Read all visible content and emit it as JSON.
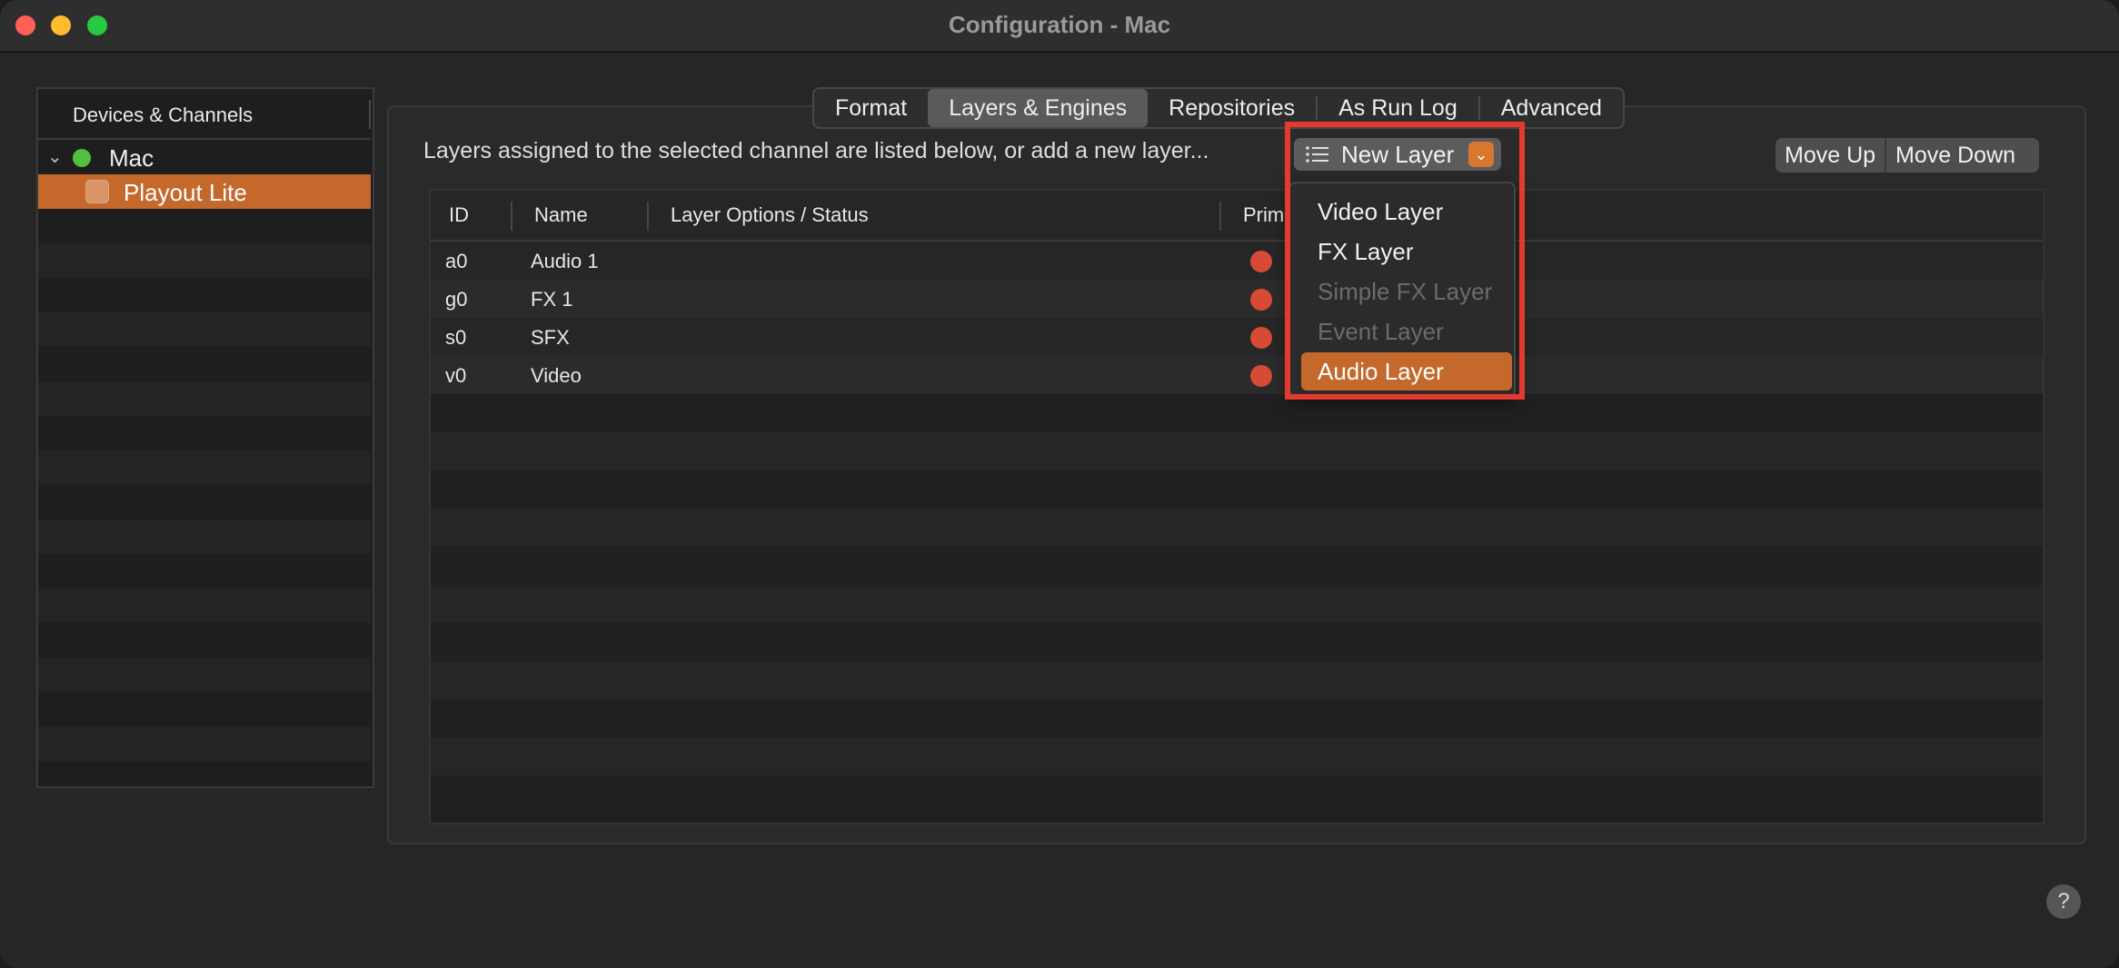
{
  "window": {
    "title": "Configuration - Mac"
  },
  "sidebar": {
    "header": "Devices & Channels",
    "device": "Mac",
    "channel": "Playout Lite"
  },
  "tabs": [
    "Format",
    "Layers & Engines",
    "Repositories",
    "As Run Log",
    "Advanced"
  ],
  "active_tab": "Layers & Engines",
  "main": {
    "info_text": "Layers assigned to the selected channel are listed below, or add a new layer...",
    "new_layer_label": "New Layer",
    "move_up_label": "Move Up",
    "move_down_label": "Move Down"
  },
  "table": {
    "columns": [
      "ID",
      "Name",
      "Layer Options / Status",
      "Prim"
    ],
    "rows": [
      {
        "id": "a0",
        "name": "Audio 1"
      },
      {
        "id": "g0",
        "name": "FX 1"
      },
      {
        "id": "s0",
        "name": "SFX"
      },
      {
        "id": "v0",
        "name": "Video"
      }
    ]
  },
  "dropdown": {
    "items": [
      {
        "label": "Video Layer",
        "enabled": true
      },
      {
        "label": "FX Layer",
        "enabled": true
      },
      {
        "label": "Simple FX Layer",
        "enabled": false
      },
      {
        "label": "Event Layer",
        "enabled": false
      },
      {
        "label": "Audio Layer",
        "enabled": true,
        "selected": true
      }
    ]
  },
  "help_label": "?",
  "colors": {
    "accent": "#c4682b",
    "status_red": "#d64a36",
    "device_online": "#52c03e",
    "highlight_box": "#e43a2e"
  }
}
